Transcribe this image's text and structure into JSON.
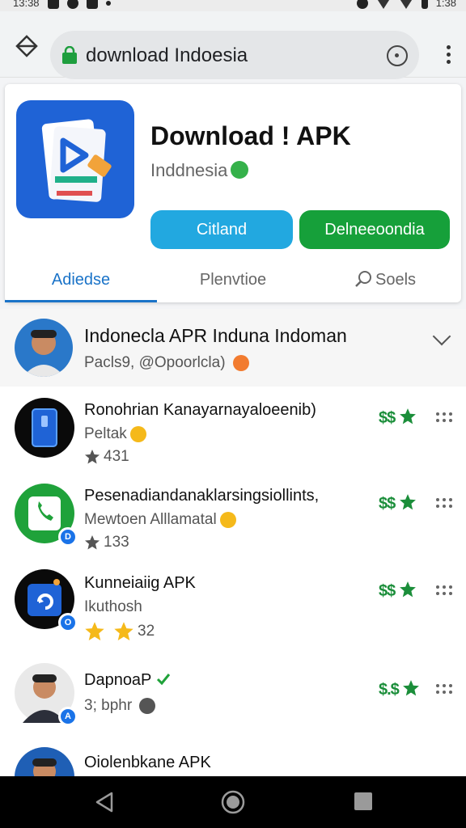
{
  "status_bar": {
    "time_left": "13:38",
    "time_right": "1:38"
  },
  "browser": {
    "url": "download Indoesia"
  },
  "app": {
    "title": "Download ! APK",
    "subtitle": "Inddnesia",
    "install_label": "Citland",
    "open_label": "Delneeoondia",
    "tabs": [
      {
        "label": "Adiedse",
        "active": true
      },
      {
        "label": "Plenvtioe",
        "active": false
      },
      {
        "label": "Soels",
        "active": false
      }
    ]
  },
  "featured": {
    "title": "Indonecla APR Induna Indoman",
    "subtitle": "Pacls9, @Opoorlcla)"
  },
  "list": [
    {
      "title": "Ronohrian Kanayarnayaloeenib)",
      "sub": "Peltak",
      "rating": "431",
      "price": "$$",
      "badge": ""
    },
    {
      "title": "Pesenadiandanaklarsingsiollints,",
      "sub": "Mewtoen Alllamatal",
      "rating": "133",
      "price": "$$",
      "badge": "D"
    },
    {
      "title": "Kunneiaiig APK",
      "sub": "Ikuthosh",
      "rating": "32",
      "price": "$$",
      "badge": "O"
    },
    {
      "title": "DapnoaP",
      "sub": "3; bphr",
      "rating": "",
      "price": "$.$",
      "badge": "A"
    },
    {
      "title": "Oiolenbkane APK",
      "sub": "",
      "rating": "",
      "price": "",
      "badge": ""
    }
  ],
  "colors": {
    "install": "#22a8e0",
    "open": "#16a03a",
    "accent": "#1a73c8",
    "price": "#1b8e3a"
  }
}
